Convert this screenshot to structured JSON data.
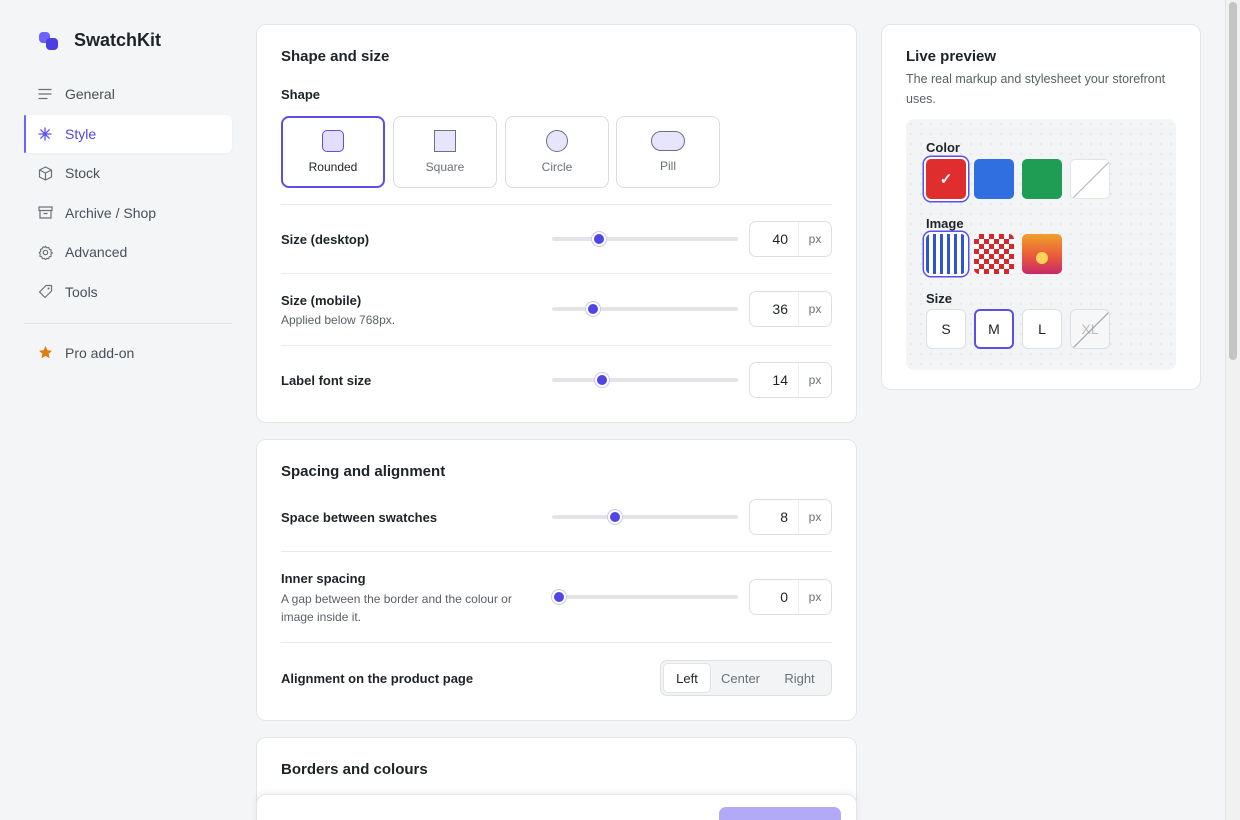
{
  "app": {
    "name": "SwatchKit"
  },
  "sidebar": {
    "items": [
      {
        "label": "General",
        "icon": "lines-icon"
      },
      {
        "label": "Style",
        "icon": "sparkle-icon",
        "active": true
      },
      {
        "label": "Stock",
        "icon": "box-icon"
      },
      {
        "label": "Archive / Shop",
        "icon": "archive-icon"
      },
      {
        "label": "Advanced",
        "icon": "gear-icon"
      },
      {
        "label": "Tools",
        "icon": "tag-icon"
      }
    ],
    "pro": {
      "label": "Pro add-on",
      "icon": "star-icon"
    }
  },
  "shape_card": {
    "title": "Shape and size",
    "shape_label": "Shape",
    "shapes": [
      {
        "label": "Rounded",
        "selected": true
      },
      {
        "label": "Square"
      },
      {
        "label": "Circle"
      },
      {
        "label": "Pill"
      }
    ],
    "rows": [
      {
        "label": "Size (desktop)",
        "value": "40",
        "unit": "px",
        "slider_fraction": 0.25
      },
      {
        "label": "Size (mobile)",
        "help": "Applied below 768px.",
        "value": "36",
        "unit": "px",
        "slider_fraction": 0.22
      },
      {
        "label": "Label font size",
        "value": "14",
        "unit": "px",
        "slider_fraction": 0.27
      }
    ]
  },
  "spacing_card": {
    "title": "Spacing and alignment",
    "rows": [
      {
        "label": "Space between swatches",
        "value": "8",
        "unit": "px",
        "slider_fraction": 0.34
      },
      {
        "label": "Inner spacing",
        "help": "A gap between the border and the colour or image inside it.",
        "value": "0",
        "unit": "px",
        "slider_fraction": 0.04
      }
    ],
    "alignment": {
      "label": "Alignment on the product page",
      "options": [
        "Left",
        "Center",
        "Right"
      ],
      "selected": "Left"
    }
  },
  "borders_card": {
    "title": "Borders and colours"
  },
  "preview": {
    "title": "Live preview",
    "description": "The real markup and stylesheet your storefront uses.",
    "color_label": "Color",
    "colors": [
      "#e02d2d",
      "#2f6fe0",
      "#1f9d55"
    ],
    "check_glyph": "✓",
    "image_label": "Image",
    "size_label": "Size",
    "sizes": [
      "S",
      "M",
      "L",
      "XL"
    ],
    "selected_size": "M",
    "disabled_size": "XL"
  },
  "accent": "#4f46e5"
}
